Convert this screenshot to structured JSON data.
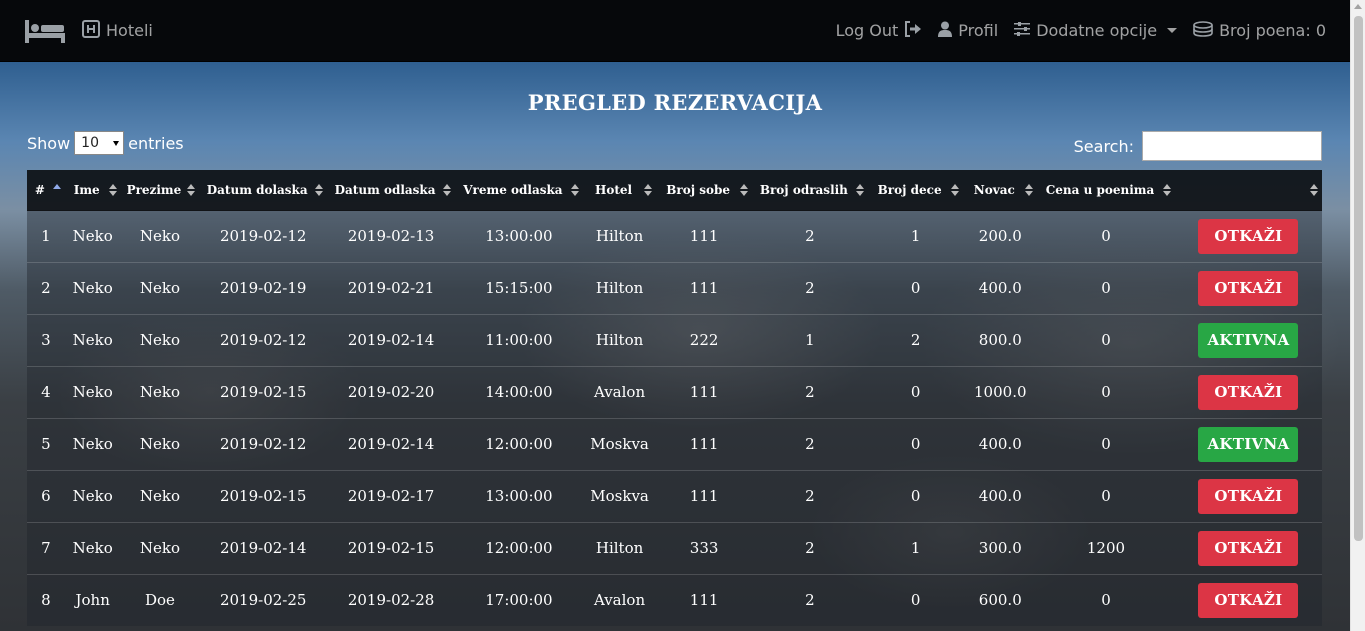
{
  "nav": {
    "brand_icon": "bed-icon",
    "hotels_label": "Hoteli",
    "logout_label": "Log Out",
    "profile_label": "Profil",
    "options_label": "Dodatne opcije",
    "points_label": "Broj poena: 0"
  },
  "page": {
    "title": "PREGLED REZERVACIJA"
  },
  "controls": {
    "show_label": "Show",
    "entries_value": "10",
    "entries_label": "entries",
    "search_label": "Search:",
    "search_value": ""
  },
  "table": {
    "columns": [
      "#",
      "Ime",
      "Prezime",
      "Datum dolaska",
      "Datum odlaska",
      "Vreme odlaska",
      "Hotel",
      "Broj sobe",
      "Broj odraslih",
      "Broj dece",
      "Novac",
      "Cena u poenima",
      ""
    ],
    "rows": [
      [
        "1",
        "Neko",
        "Neko",
        "2019-02-12",
        "2019-02-13",
        "13:00:00",
        "Hilton",
        "111",
        "2",
        "1",
        "200.0",
        "0",
        "OTKAŽI"
      ],
      [
        "2",
        "Neko",
        "Neko",
        "2019-02-19",
        "2019-02-21",
        "15:15:00",
        "Hilton",
        "111",
        "2",
        "0",
        "400.0",
        "0",
        "OTKAŽI"
      ],
      [
        "3",
        "Neko",
        "Neko",
        "2019-02-12",
        "2019-02-14",
        "11:00:00",
        "Hilton",
        "222",
        "1",
        "2",
        "800.0",
        "0",
        "AKTIVNA"
      ],
      [
        "4",
        "Neko",
        "Neko",
        "2019-02-15",
        "2019-02-20",
        "14:00:00",
        "Avalon",
        "111",
        "2",
        "0",
        "1000.0",
        "0",
        "OTKAŽI"
      ],
      [
        "5",
        "Neko",
        "Neko",
        "2019-02-12",
        "2019-02-14",
        "12:00:00",
        "Moskva",
        "111",
        "2",
        "0",
        "400.0",
        "0",
        "AKTIVNA"
      ],
      [
        "6",
        "Neko",
        "Neko",
        "2019-02-15",
        "2019-02-17",
        "13:00:00",
        "Moskva",
        "111",
        "2",
        "0",
        "400.0",
        "0",
        "OTKAŽI"
      ],
      [
        "7",
        "Neko",
        "Neko",
        "2019-02-14",
        "2019-02-15",
        "12:00:00",
        "Hilton",
        "333",
        "2",
        "1",
        "300.0",
        "1200",
        "OTKAŽI"
      ],
      [
        "8",
        "John",
        "Doe",
        "2019-02-25",
        "2019-02-28",
        "17:00:00",
        "Avalon",
        "111",
        "2",
        "0",
        "600.0",
        "0",
        "OTKAŽI"
      ]
    ]
  },
  "colors": {
    "cancel": "#dc3545",
    "active": "#28a745",
    "navbar": "#06080b"
  }
}
